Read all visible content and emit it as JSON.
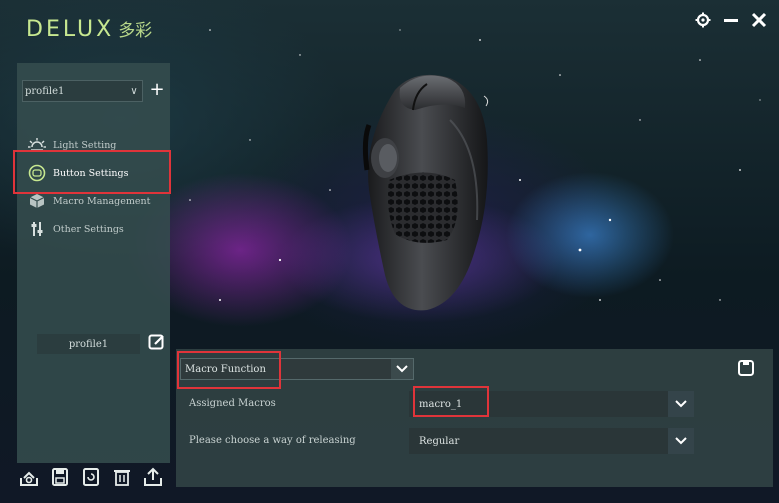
{
  "app": {
    "brand": "DELUX",
    "brand_cn": "多彩"
  },
  "sidebar": {
    "profile_select": "profile1",
    "menu": [
      {
        "label": "Light Setting",
        "icon": "sun-icon"
      },
      {
        "label": "Button Settings",
        "icon": "mouse-button-icon",
        "active": true
      },
      {
        "label": "Macro Management",
        "icon": "cube-icon"
      },
      {
        "label": "Other Settings",
        "icon": "sliders-icon"
      }
    ],
    "profile_name": "profile1"
  },
  "panel": {
    "function_select": "Macro Function",
    "assigned_label": "Assigned Macros",
    "assigned_value": "macro_1",
    "release_label": "Please choose a way of releasing",
    "release_value": "Regular"
  },
  "colors": {
    "accent_green": "#c7e890",
    "highlight_red": "#e0343a",
    "sidebar_bg": "#344c4d",
    "panel_bg": "#2f4042"
  }
}
